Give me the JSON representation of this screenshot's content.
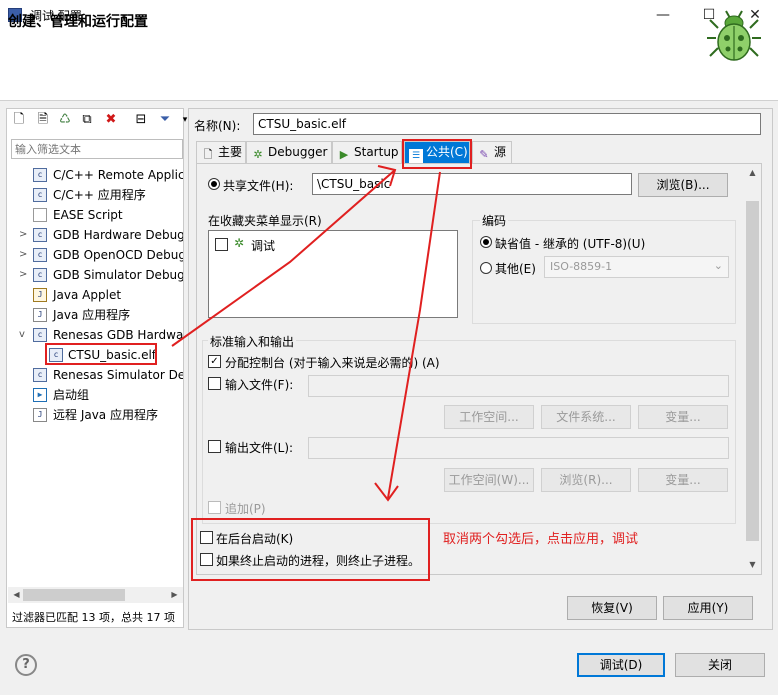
{
  "window": {
    "title": "调试 配置",
    "minimize": "—",
    "maximize": "☐",
    "close": "✕"
  },
  "header": {
    "title": "创建、管理和运行配置"
  },
  "left": {
    "filter_placeholder": "输入筛选文本",
    "tree": [
      {
        "label": "C/C++ Remote Applica",
        "icon": "C",
        "expander": ""
      },
      {
        "label": "C/C++ 应用程序",
        "icon": "C",
        "expander": ""
      },
      {
        "label": "EASE Script",
        "icon": "",
        "expander": ""
      },
      {
        "label": "GDB Hardware Debugg",
        "icon": "C",
        "expander": ">"
      },
      {
        "label": "GDB OpenOCD Debugg",
        "icon": "C",
        "expander": ">"
      },
      {
        "label": "GDB Simulator Debugg",
        "icon": "C",
        "expander": ">"
      },
      {
        "label": "Java Applet",
        "icon": "J",
        "expander": ""
      },
      {
        "label": "Java 应用程序",
        "icon": "J",
        "expander": ""
      },
      {
        "label": "Renesas GDB Hardwar",
        "icon": "C",
        "expander": "v"
      },
      {
        "label": "CTSU_basic.elf",
        "icon": "C",
        "expander": ""
      },
      {
        "label": "Renesas Simulator Deb",
        "icon": "C",
        "expander": ""
      },
      {
        "label": "启动组",
        "icon": "▶",
        "expander": ""
      },
      {
        "label": "远程 Java 应用程序",
        "icon": "J",
        "expander": ""
      }
    ],
    "status": "过滤器已匹配 13 项，总共 17 项"
  },
  "config": {
    "name_label": "名称(N):",
    "name_value": "CTSU_basic.elf",
    "tabs": [
      {
        "label": "主要",
        "icon": "main-icon"
      },
      {
        "label": "Debugger",
        "icon": "debugger-icon"
      },
      {
        "label": "Startup",
        "icon": "startup-icon"
      },
      {
        "label": "公共(C)",
        "icon": "common-icon",
        "active": true
      },
      {
        "label": "源",
        "icon": "source-icon"
      }
    ],
    "shared_file_label": "共享文件(H):",
    "shared_file_value": "\\CTSU_basic",
    "browse_button": "浏览(B)...",
    "favorites_title": "在收藏夹菜单显示(R)",
    "favorites_item": "调试",
    "encoding_title": "编码",
    "encoding_default": "缺省值 - 继承的 (UTF-8)(U)",
    "encoding_other": "其他(E)",
    "encoding_select": "ISO-8859-1",
    "io_title": "标准输入和输出",
    "allocate_console": "分配控制台 (对于输入来说是必需的) (A)",
    "input_file": "输入文件(F):",
    "workspace_btn1": "工作空间...",
    "filesystem_btn": "文件系统...",
    "variables_btn1": "变量...",
    "output_file": "输出文件(L):",
    "workspace_btn2": "工作空间(W)...",
    "browse_btn2": "浏览(R)...",
    "variables_btn2": "变量...",
    "append": "追加(P)",
    "launch_background": "在后台启动(K)",
    "terminate_children": "如果终止启动的进程，则终止子进程。",
    "revert_button": "恢复(V)",
    "apply_button": "应用(Y)"
  },
  "footer": {
    "help": "?",
    "debug_button": "调试(D)",
    "close_button": "关闭"
  },
  "annotation": {
    "text": "取消两个勾选后，点击应用，调试",
    "color": "#e02020"
  }
}
